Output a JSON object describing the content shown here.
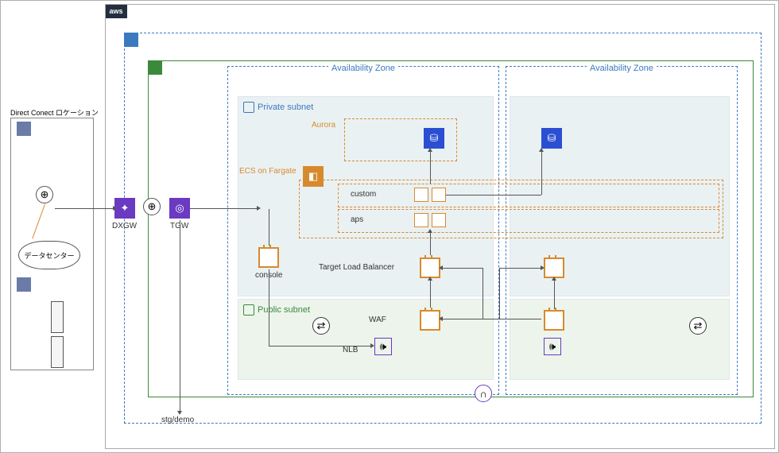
{
  "aws_logo": "aws",
  "labels": {
    "az": "Availability Zone",
    "private_subnet": "Private subnet",
    "public_subnet": "Public subnet",
    "aurora": "Aurora",
    "ecs_fargate": "ECS on Fargate",
    "custom": "custom",
    "aps": "aps",
    "console": "console",
    "tlb": "Target Load Balancer",
    "waf": "WAF",
    "nlb": "NLB",
    "dxgw": "DXGW",
    "tgw": "TGW",
    "stg_demo": "stg/demo",
    "dc_location": "Direct Conect ロケーション",
    "datacenter": "データセンター"
  }
}
